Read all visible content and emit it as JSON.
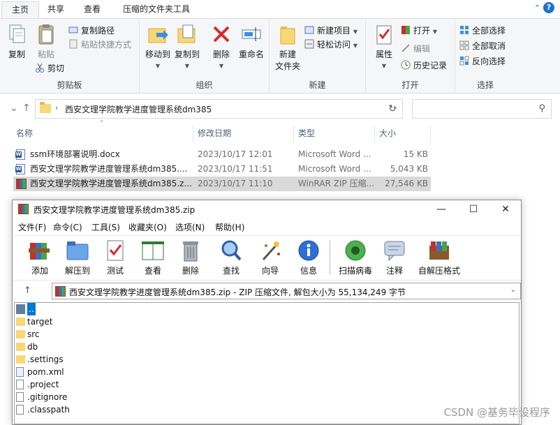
{
  "ribbon_tabs": [
    "主页",
    "共享",
    "查看",
    "压缩的文件夹工具"
  ],
  "ribbon": {
    "clipboard": {
      "label": "剪贴板",
      "copy": "复制",
      "paste": "粘贴",
      "copy_path": "复制路径",
      "paste_shortcut": "粘贴快捷方式",
      "cut": "剪切"
    },
    "organize": {
      "label": "组织",
      "move_to": "移动到",
      "copy_to": "复制到",
      "delete": "删除",
      "rename": "重命名"
    },
    "new": {
      "label": "新建",
      "new_folder": "新建\n文件夹",
      "new_folder_l1": "新建",
      "new_folder_l2": "文件夹",
      "new_item": "新建项目",
      "easy_access": "轻松访问"
    },
    "open": {
      "label": "打开",
      "properties": "属性",
      "open": "打开",
      "edit": "编辑",
      "history": "历史记录"
    },
    "select": {
      "label": "选择",
      "select_all": "全部选择",
      "select_none": "全部取消",
      "invert": "反向选择"
    }
  },
  "address": {
    "path": "西安文理学院教学进度管理系统dm385"
  },
  "columns": [
    "名称",
    "修改日期",
    "类型",
    "大小"
  ],
  "files": [
    {
      "name": "ssm环境部署说明.docx",
      "date": "2023/10/17 12:01",
      "type": "Microsoft Word ...",
      "size": "15 KB"
    },
    {
      "name": "西安文理学院教学进度管理系统dm385....",
      "date": "2023/10/17 11:51",
      "type": "Microsoft Word ...",
      "size": "5,043 KB"
    },
    {
      "name": "西安文理学院教学进度管理系统dm385.z...",
      "date": "2023/10/17 11:10",
      "type": "WinRAR ZIP 压缩...",
      "size": "27,546 KB"
    }
  ],
  "winrar": {
    "title": "西安文理学院教学进度管理系统dm385.zip",
    "menus": [
      "文件(F)",
      "命令(C)",
      "工具(S)",
      "收藏夹(O)",
      "选项(N)",
      "帮助(H)"
    ],
    "toolbar": [
      "添加",
      "解压到",
      "测试",
      "查看",
      "删除",
      "查找",
      "向导",
      "信息",
      "扫描病毒",
      "注释",
      "自解压格式"
    ],
    "path": "西安文理学院教学进度管理系统dm385.zip - ZIP 压缩文件, 解包大小为 55,134,249 字节",
    "items": [
      "..",
      "target",
      "src",
      "db",
      ".settings",
      "pom.xml",
      ".project",
      ".gitignore",
      ".classpath"
    ]
  },
  "watermark": "CSDN @基务毕设程序"
}
